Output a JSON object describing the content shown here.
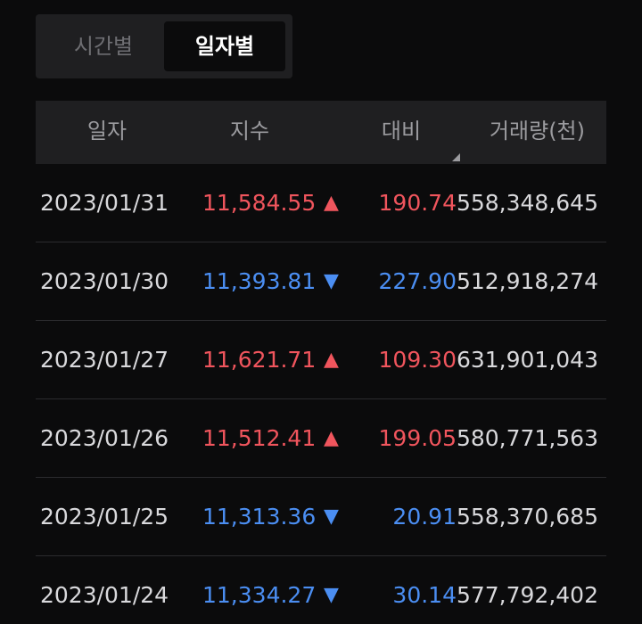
{
  "toggle": {
    "hourly_label": "시간별",
    "daily_label": "일자별",
    "selected": "일자별"
  },
  "table": {
    "headers": {
      "date": "일자",
      "index": "지수",
      "change": "대비",
      "volume": "거래량(천)"
    },
    "rows": [
      {
        "date": "2023/01/31",
        "index": "11,584.55",
        "arrow": "▲",
        "change": "190.74",
        "volume": "558,348,645",
        "direction": "up"
      },
      {
        "date": "2023/01/30",
        "index": "11,393.81",
        "arrow": "▼",
        "change": "227.90",
        "volume": "512,918,274",
        "direction": "down"
      },
      {
        "date": "2023/01/27",
        "index": "11,621.71",
        "arrow": "▲",
        "change": "109.30",
        "volume": "631,901,043",
        "direction": "up"
      },
      {
        "date": "2023/01/26",
        "index": "11,512.41",
        "arrow": "▲",
        "change": "199.05",
        "volume": "580,771,563",
        "direction": "up"
      },
      {
        "date": "2023/01/25",
        "index": "11,313.36",
        "arrow": "▼",
        "change": "20.91",
        "volume": "558,370,685",
        "direction": "down"
      },
      {
        "date": "2023/01/24",
        "index": "11,334.27",
        "arrow": "▼",
        "change": "30.14",
        "volume": "577,792,402",
        "direction": "down"
      }
    ]
  },
  "colors": {
    "up": "#f0555d",
    "down": "#4b8ef2",
    "background": "#0b0b0c",
    "panel": "#1f1f21"
  }
}
